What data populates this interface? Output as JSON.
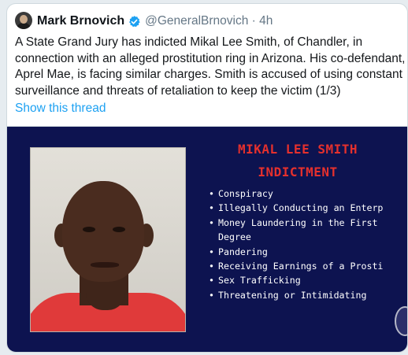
{
  "tweet": {
    "author_name": "Mark Brnovich",
    "handle_time": "@GeneralBrnovich · 4h",
    "text": "A State Grand Jury has indicted Mikal Lee Smith, of Chandler, in connection with an alleged prostitution ring in Arizona. His co-defendant, Aprel Mae, is facing similar charges. Smith is accused of using constant surveillance and threats of retaliation to keep the victim (1/3)",
    "thread_link": "Show this thread"
  },
  "media": {
    "title_line1": "MIKAL LEE SMITH",
    "title_line2": "INDICTMENT",
    "charges": [
      "Conspiracy",
      "Illegally Conducting an Enterp",
      "Money Laundering in the First",
      "Degree",
      "Pandering",
      "Receiving Earnings of a Prosti",
      "Sex Trafficking",
      "Threatening or Intimidating"
    ]
  },
  "icons": {
    "verified": "verified-badge-icon",
    "avatar": "profile-avatar"
  },
  "colors": {
    "accent": "#1da1f2",
    "media_background": "#0d1350",
    "media_title": "#e5302d"
  }
}
